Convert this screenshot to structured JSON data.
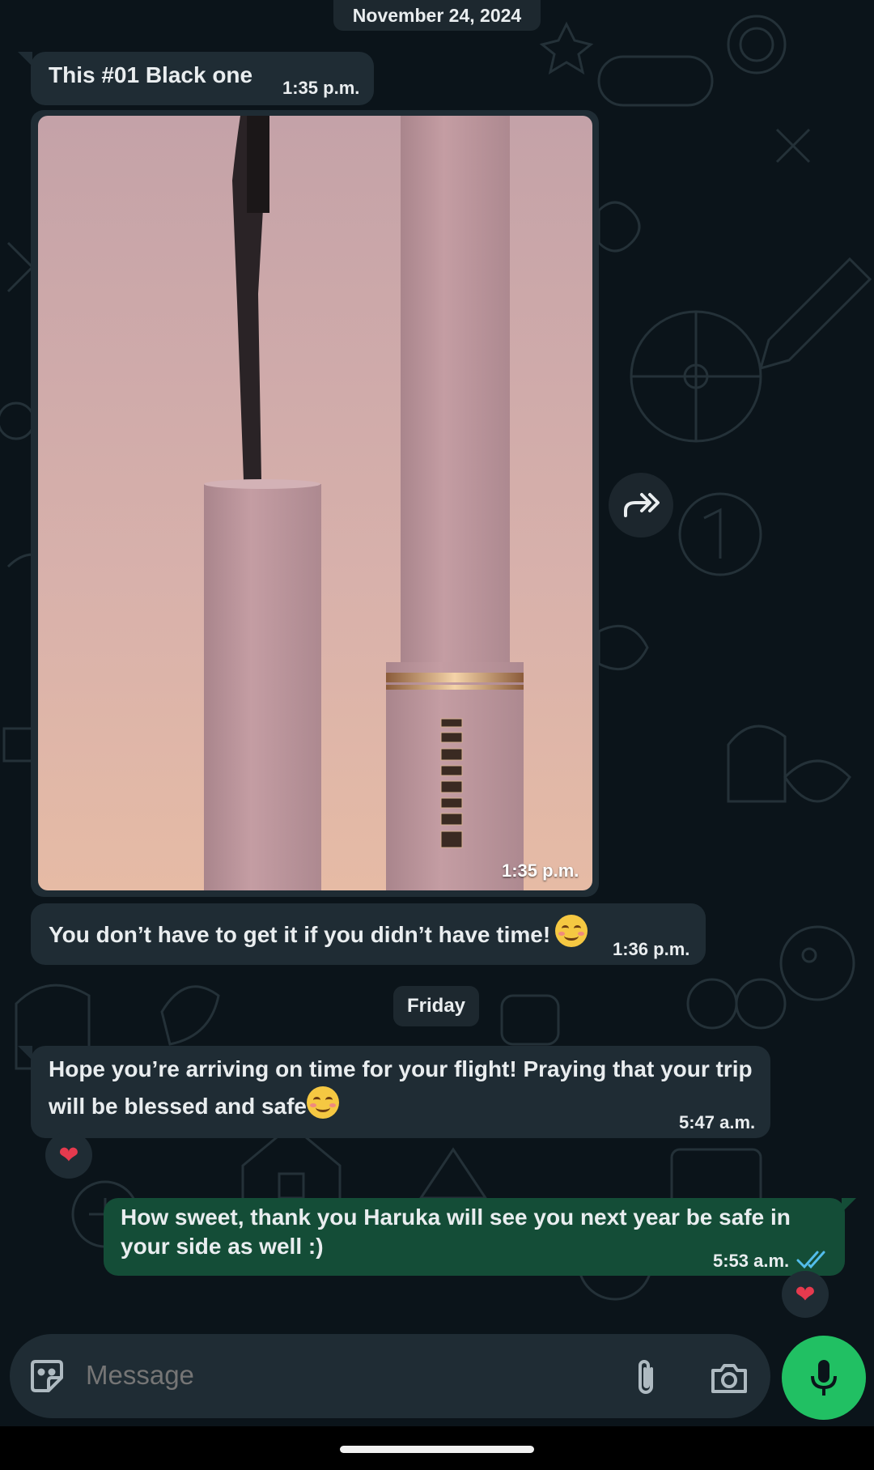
{
  "date_divider": "November 24, 2024",
  "messages": [
    {
      "text": "This #01 Black one",
      "time": "1:35 p.m."
    },
    {
      "image_time": "1:35 p.m."
    },
    {
      "text": "You don’t have to get it if you didn’t have time!",
      "time": "1:36 p.m."
    }
  ],
  "day_divider": "Friday",
  "later_messages": [
    {
      "line1": "Hope you’re arriving on time for your flight! Praying that your trip",
      "line2": "will be blessed and safe",
      "time": "5:47 a.m.",
      "reaction": "❤"
    },
    {
      "line1": "How sweet, thank you Haruka will see you next year be safe in",
      "line2": "your side as well :)",
      "time": "5:53 a.m.",
      "reaction": "❤",
      "status": "read"
    }
  ],
  "composer": {
    "placeholder": "Message"
  },
  "colors": {
    "incoming": "#1f2c34",
    "outgoing": "#144d37",
    "accent": "#21c063",
    "read_ticks": "#53bdeb"
  },
  "icons": [
    "forward-icon",
    "sticker-icon",
    "attach-icon",
    "camera-icon",
    "mic-icon",
    "heart-icon",
    "double-check-icon"
  ]
}
